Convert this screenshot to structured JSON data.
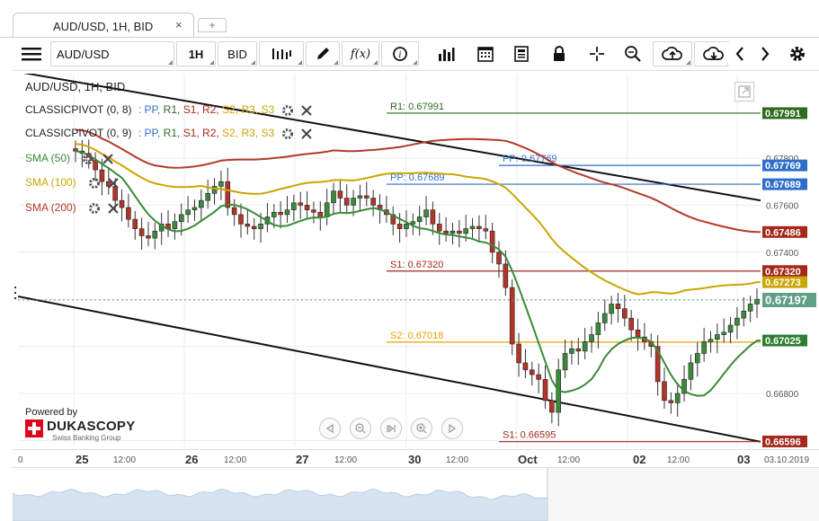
{
  "tab": {
    "title": "AUD/USD, 1H, BID",
    "close": "×",
    "add": "+"
  },
  "toolbar": {
    "symbol": "AUD/USD",
    "period": "1H",
    "side": "BID",
    "fx_label": "f(x)"
  },
  "chart": {
    "header": "AUD/USD, 1H, BID",
    "pivots": [
      {
        "label": "CLASSICPIVOT (0, 8)",
        "items": [
          "PP,",
          "R1,",
          "S1,",
          "R2,",
          "S2,",
          "R3,",
          "S3"
        ]
      },
      {
        "label": "CLASSICPIVOT (0, 9)",
        "items": [
          "PP,",
          "R1,",
          "S1,",
          "R2,",
          "S2,",
          "R3,",
          "S3"
        ]
      }
    ],
    "pivot_separator": ":",
    "sma": [
      {
        "label": "SMA (50)",
        "color": "#3a8a3a"
      },
      {
        "label": "SMA (100)",
        "color": "#c9a600"
      },
      {
        "label": "SMA (200)",
        "color": "#b33a2a"
      }
    ],
    "level_labels": {
      "r1": "R1: 0.67991",
      "pp_a": "PP: 0.67769",
      "pp_b": "PP: 0.67689",
      "s1": "S1: 0.67320",
      "s2": "S2: 0.67018",
      "s1_b": "S1: 0.66595"
    },
    "price_ticks": [
      "0.67800",
      "0.67600",
      "0.67400",
      "0.66800"
    ],
    "price_badges": [
      {
        "value": "0.67991",
        "color": "#2e6b1e"
      },
      {
        "value": "0.67769",
        "color": "#2f6fc9"
      },
      {
        "value": "0.67689",
        "color": "#2f6fc9"
      },
      {
        "value": "0.67486",
        "color": "#a5281b"
      },
      {
        "value": "0.67320",
        "color": "#a5281b"
      },
      {
        "value": "0.67273",
        "color": "#c9a600"
      },
      {
        "value": "0.67197",
        "color": "#5f9f86"
      },
      {
        "value": "0.67025",
        "color": "#2e7d32"
      },
      {
        "value": "0.66596",
        "color": "#a5281b"
      }
    ],
    "powered_by": "Powered by",
    "brand": "DUKASCOPY",
    "brand_sub": "Swiss Banking Group"
  },
  "time_axis": {
    "labels": [
      {
        "text": "0",
        "big": false
      },
      {
        "text": "25",
        "big": true
      },
      {
        "text": "12:00",
        "big": false
      },
      {
        "text": "26",
        "big": true
      },
      {
        "text": "12:00",
        "big": false
      },
      {
        "text": "27",
        "big": true
      },
      {
        "text": "12:00",
        "big": false
      },
      {
        "text": "30",
        "big": true
      },
      {
        "text": "12:00",
        "big": false
      },
      {
        "text": "Oct",
        "big": true
      },
      {
        "text": "12:00",
        "big": false
      },
      {
        "text": "02",
        "big": true
      },
      {
        "text": "12:00",
        "big": false
      },
      {
        "text": "03",
        "big": true
      },
      {
        "text": "03.10.2019",
        "big": false
      }
    ]
  },
  "chart_data": {
    "type": "candlestick",
    "symbol": "AUD/USD",
    "timeframe": "1H",
    "side": "BID",
    "levels": {
      "R1": 0.67991,
      "PP_a": 0.67769,
      "PP_b": 0.67689,
      "S1": 0.6732,
      "S2": 0.67018,
      "S1_b": 0.66595
    },
    "sma_last": {
      "SMA50": 0.67025,
      "SMA100": 0.67273,
      "SMA200": 0.67486
    },
    "last_price": 0.67197,
    "close_series": [
      0.6783,
      0.6782,
      0.6779,
      0.6775,
      0.677,
      0.6768,
      0.6762,
      0.6759,
      0.6754,
      0.675,
      0.6747,
      0.6746,
      0.6749,
      0.6752,
      0.675,
      0.6753,
      0.6756,
      0.6758,
      0.6759,
      0.6762,
      0.6765,
      0.6768,
      0.677,
      0.6759,
      0.6756,
      0.6752,
      0.6751,
      0.675,
      0.6752,
      0.6755,
      0.6757,
      0.6756,
      0.6758,
      0.6761,
      0.676,
      0.6758,
      0.6757,
      0.6755,
      0.6761,
      0.6766,
      0.6763,
      0.676,
      0.6763,
      0.6764,
      0.6763,
      0.676,
      0.6758,
      0.6756,
      0.6752,
      0.675,
      0.6752,
      0.6753,
      0.6755,
      0.6758,
      0.6752,
      0.6749,
      0.6748,
      0.6749,
      0.6748,
      0.675,
      0.6751,
      0.675,
      0.6749,
      0.674,
      0.6735,
      0.6725,
      0.6701,
      0.6693,
      0.669,
      0.6688,
      0.6686,
      0.6677,
      0.6672,
      0.669,
      0.6697,
      0.6699,
      0.6698,
      0.6702,
      0.6705,
      0.671,
      0.6714,
      0.6718,
      0.6716,
      0.6712,
      0.6707,
      0.6704,
      0.6702,
      0.67,
      0.6685,
      0.6677,
      0.6676,
      0.668,
      0.6686,
      0.6693,
      0.6697,
      0.6702,
      0.6703,
      0.6705,
      0.6706,
      0.6709,
      0.6712,
      0.6715,
      0.6718,
      0.672
    ]
  }
}
